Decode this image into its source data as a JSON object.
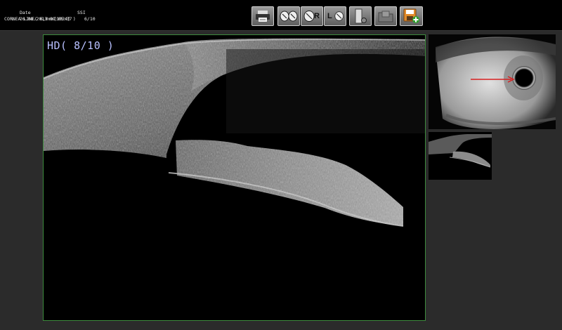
{
  "header": {
    "scan_title": "CORNEA LINE( 6,0mm[1024] )",
    "date_label": "Date",
    "ssi_label": "SSI",
    "eye": "L",
    "datetime": "26.08.2013 09:05:37",
    "ssi_value": "6/10"
  },
  "toolbar": {
    "buttons": [
      {
        "name": "print-report",
        "icon": "printer-icon"
      },
      {
        "name": "view-both-eyes",
        "icon": "eyes-icon"
      },
      {
        "name": "view-right-eye",
        "icon": "right-eye-icon",
        "label": "R"
      },
      {
        "name": "view-left-eye",
        "icon": "left-eye-icon",
        "label": "L"
      },
      {
        "name": "scan-settings",
        "icon": "device-icon"
      },
      {
        "name": "open-folder",
        "icon": "folder-icon"
      },
      {
        "name": "save-add",
        "icon": "save-add-icon"
      }
    ]
  },
  "scan": {
    "quality_label": "HD( 8/10 )"
  },
  "colors": {
    "panel_border": "#3d8a3d",
    "quality_text": "#b8c0ff",
    "scan_line": "#d82020"
  }
}
